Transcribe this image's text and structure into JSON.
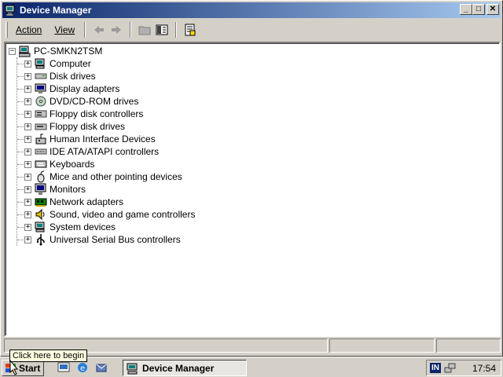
{
  "window": {
    "title": "Device Manager",
    "minimize": "_",
    "maximize": "□",
    "close": "✕"
  },
  "menu": {
    "action": "Action",
    "view": "View"
  },
  "toolbar": {
    "back_icon": "arrow-left-icon",
    "forward_icon": "arrow-right-icon",
    "up_icon": "folder-up-icon",
    "show_hide_tree_icon": "tree-pane-icon",
    "properties_icon": "properties-icon"
  },
  "tree": {
    "root": "PC-SMKN2TSM",
    "expander_collapsed": "+",
    "expander_expanded": "−",
    "categories": [
      {
        "label": "Computer",
        "icon": "computer-icon"
      },
      {
        "label": "Disk drives",
        "icon": "disk-drive-icon"
      },
      {
        "label": "Display adapters",
        "icon": "display-adapter-icon"
      },
      {
        "label": "DVD/CD-ROM drives",
        "icon": "cdrom-icon"
      },
      {
        "label": "Floppy disk controllers",
        "icon": "floppy-controller-icon"
      },
      {
        "label": "Floppy disk drives",
        "icon": "floppy-drive-icon"
      },
      {
        "label": "Human Interface Devices",
        "icon": "hid-icon"
      },
      {
        "label": "IDE ATA/ATAPI controllers",
        "icon": "ide-controller-icon"
      },
      {
        "label": "Keyboards",
        "icon": "keyboard-icon"
      },
      {
        "label": "Mice and other pointing devices",
        "icon": "mouse-icon"
      },
      {
        "label": "Monitors",
        "icon": "monitor-icon"
      },
      {
        "label": "Network adapters",
        "icon": "network-adapter-icon"
      },
      {
        "label": "Sound, video and game controllers",
        "icon": "sound-icon"
      },
      {
        "label": "System devices",
        "icon": "system-device-icon"
      },
      {
        "label": "Universal Serial Bus controllers",
        "icon": "usb-icon"
      }
    ]
  },
  "taskbar": {
    "start_label": "Start",
    "tooltip": "Click here to begin",
    "task_label": "Device Manager",
    "lang": "IN",
    "clock": "17:54"
  },
  "colors": {
    "title_start": "#0a246a",
    "title_end": "#a6caf0",
    "face": "#d4d0c8"
  }
}
